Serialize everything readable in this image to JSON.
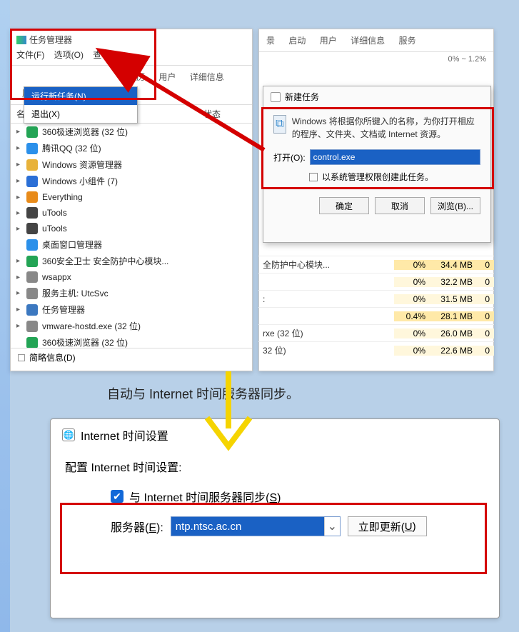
{
  "task_manager": {
    "title": "任务管理器",
    "menus": {
      "file": "文件(F)",
      "options": "选项(O)",
      "view": "查看(V)"
    },
    "file_menu": {
      "run_new": "运行新任务(N)",
      "exit": "退出(X)"
    },
    "tabs": {
      "processes_prefix": "历",
      "performance_suffix": "用户",
      "details": "详细信息",
      "services": "服务"
    },
    "col": {
      "name": "名称",
      "status": "状态"
    },
    "processes": [
      {
        "name": "360极速浏览器 (32 位)",
        "ico": "#23a455",
        "caret": true
      },
      {
        "name": "腾讯QQ (32 位)",
        "ico": "#2b90ea",
        "caret": true
      },
      {
        "name": "Windows 资源管理器",
        "ico": "#e8b23a",
        "caret": true
      },
      {
        "name": "Windows 小组件 (7)",
        "ico": "#2b6fd6",
        "caret": true
      },
      {
        "name": "Everything",
        "ico": "#e88b1a",
        "caret": true
      },
      {
        "name": "uTools",
        "ico": "#444444",
        "caret": true
      },
      {
        "name": "uTools",
        "ico": "#444444",
        "caret": true
      },
      {
        "name": "桌面窗口管理器",
        "ico": "#2b90ea",
        "caret": false
      },
      {
        "name": "360安全卫士 安全防护中心模块...",
        "ico": "#23a455",
        "caret": true
      },
      {
        "name": "wsappx",
        "ico": "#888888",
        "caret": true
      },
      {
        "name": "服务主机: UtcSvc",
        "ico": "#888888",
        "caret": true
      },
      {
        "name": "任务管理器",
        "ico": "#3c78c0",
        "caret": true
      },
      {
        "name": "vmware-hostd.exe (32 位)",
        "ico": "#888888",
        "caret": true
      },
      {
        "name": "360极速浏览器 (32 位)",
        "ico": "#23a455",
        "caret": false
      }
    ],
    "briefing": "简略信息(D)"
  },
  "right_window": {
    "tabs": {
      "history": "景",
      "startup": "启动",
      "users": "用户",
      "details": "详细信息",
      "services": "服务"
    },
    "header_stats": "0%    ~    1.2%",
    "rows": [
      {
        "name": "全防护中心模块...",
        "cpu": "0%",
        "mem": "34.4 MB",
        "z": "0",
        "hl": true
      },
      {
        "name": "",
        "cpu": "0%",
        "mem": "32.2 MB",
        "z": "0",
        "hl": false
      },
      {
        "name": ":",
        "cpu": "0%",
        "mem": "31.5 MB",
        "z": "0",
        "hl": false
      },
      {
        "name": "",
        "cpu": "0.4%",
        "mem": "28.1 MB",
        "z": "0",
        "hl": true
      },
      {
        "name": "rxe (32 位)",
        "cpu": "0%",
        "mem": "26.0 MB",
        "z": "0",
        "hl": false
      },
      {
        "name": "32 位)",
        "cpu": "0%",
        "mem": "22.6 MB",
        "z": "0",
        "hl": false
      }
    ]
  },
  "run_dialog": {
    "title": "新建任务",
    "description": "Windows 将根据你所键入的名称，为你打开相应的程序、文件夹、文档或 Internet 资源。",
    "open_label": "打开(O):",
    "open_value": "control.exe",
    "admin_label": "以系统管理权限创建此任务。",
    "buttons": {
      "ok": "确定",
      "cancel": "取消",
      "browse": "浏览(B)..."
    }
  },
  "middle_text": "自动与 Internet 时间服务器同步。",
  "internet_time": {
    "title": "Internet 时间设置",
    "heading": "配置 Internet 时间设置:",
    "sync_label_pre": "与 Internet 时间服务器同步(",
    "sync_label_ul": "S",
    "sync_label_post": ")",
    "server_label_pre": "服务器(",
    "server_label_ul": "E",
    "server_label_post": "):",
    "server_value": "ntp.ntsc.ac.cn",
    "update_button_pre": "立即更新(",
    "update_button_ul": "U",
    "update_button_post": ")"
  }
}
